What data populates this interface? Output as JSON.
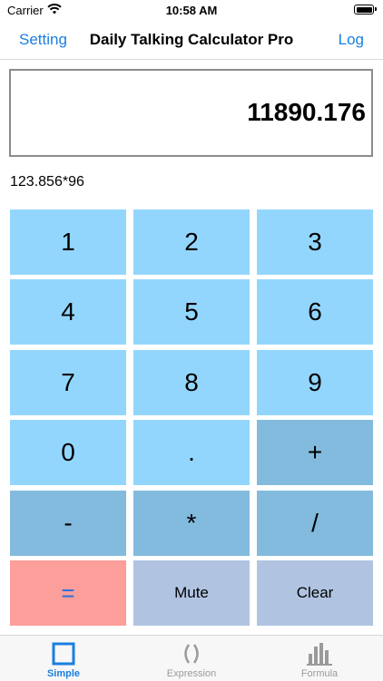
{
  "status": {
    "carrier": "Carrier",
    "time": "10:58 AM"
  },
  "nav": {
    "left": "Setting",
    "title": "Daily Talking Calculator Pro",
    "right": "Log"
  },
  "display": {
    "value": "11890.176",
    "expression": "123.856*96"
  },
  "keys": [
    [
      "1",
      "2",
      "3"
    ],
    [
      "4",
      "5",
      "6"
    ],
    [
      "7",
      "8",
      "9"
    ],
    [
      "0",
      ".",
      "+"
    ],
    [
      "-",
      "*",
      "/"
    ],
    [
      "=",
      "Mute",
      "Clear"
    ]
  ],
  "colors": {
    "digit": "#93d6fd",
    "operator": "#82bbde",
    "equals": "#fc9e9a",
    "function": "#b0c4e2",
    "accent": "#1a7ee0"
  },
  "tabs": [
    {
      "label": "Simple",
      "icon": "square-icon",
      "active": true
    },
    {
      "label": "Expression",
      "icon": "parentheses-icon",
      "active": false
    },
    {
      "label": "Formula",
      "icon": "bar-chart-icon",
      "active": false
    }
  ]
}
